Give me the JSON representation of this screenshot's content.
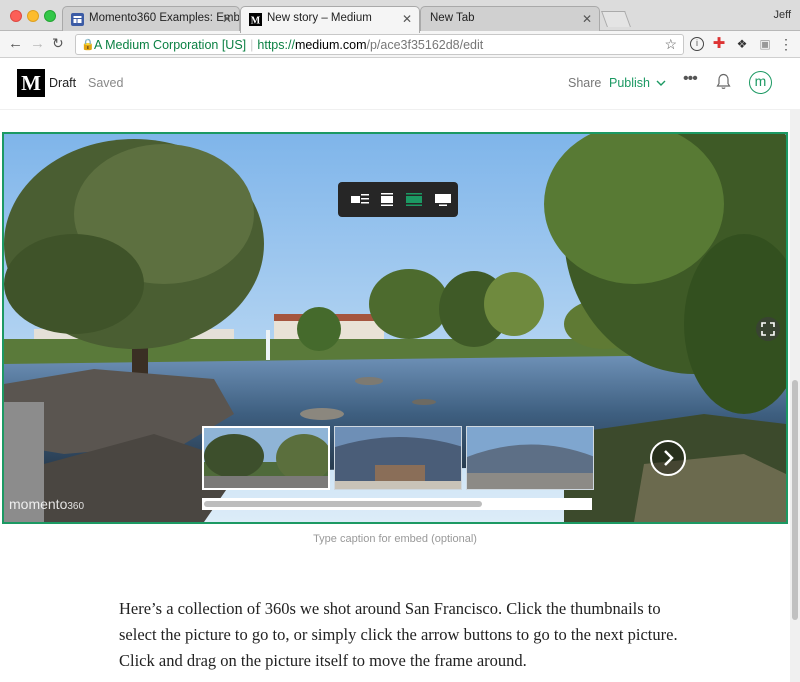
{
  "browser": {
    "tabs": [
      {
        "title": "Momento360 Examples: Embe",
        "active": false
      },
      {
        "title": "New story – Medium",
        "active": true
      },
      {
        "title": "New Tab",
        "active": false
      }
    ],
    "user": "Jeff",
    "address": {
      "secure_label": "A Medium Corporation [US]",
      "scheme": "https://",
      "host": "medium.com",
      "path": "/p/ace3f35162d8/edit"
    }
  },
  "medium": {
    "logo": "M",
    "status_draft": "Draft",
    "status_saved": "Saved",
    "share_label": "Share",
    "publish_label": "Publish",
    "more_label": "•••",
    "avatar_letter": "m",
    "accent_color": "#1c9963"
  },
  "embed": {
    "watermark": "momento",
    "watermark_sub": "360",
    "thumbnails": 3,
    "selected_thumbnail": 1,
    "progress_fraction": 0.72,
    "caption_placeholder": "Type caption for embed (optional)"
  },
  "article": {
    "paragraph": "Here’s a collection of 360s we shot around San Francisco. Click the thumbnails to select the picture to go to, or simply click the arrow buttons to go to the next picture. Click and drag on the picture itself to move the frame around."
  }
}
